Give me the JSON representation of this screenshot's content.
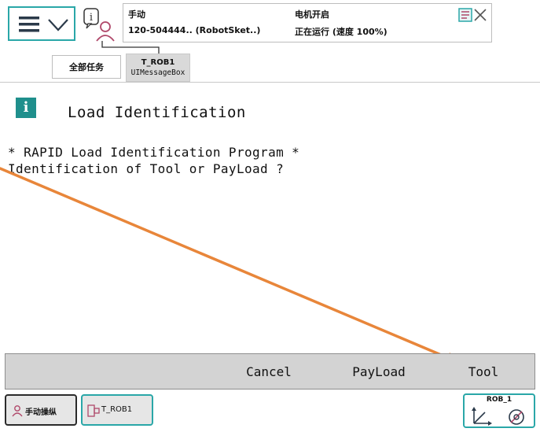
{
  "header": {
    "mode": "手动",
    "controller": "120-504444.. (RobotSket..)",
    "motor_state": "电机开启",
    "run_state": "正在运行 (速度 100%)"
  },
  "tabs": {
    "all_tasks": "全部任务",
    "task_name": "T_ROB1",
    "task_module": "UIMessageBox"
  },
  "message": {
    "title": "Load Identification",
    "lines": [
      "* RAPID Load Identification Program *",
      "Identification of Tool or PayLoad ?"
    ]
  },
  "buttons": {
    "cancel": "Cancel",
    "payload": "PayLoad",
    "tool": "Tool"
  },
  "taskbar": {
    "manual_jog": "手动操纵",
    "task": "T_ROB1",
    "mechunit": "ROB_1"
  },
  "colors": {
    "accent": "#2aa7a8",
    "info_icon": "#1f8f8c",
    "arrow": "#e8863a",
    "button_bar": "#d3d3d3"
  },
  "icons": {
    "menu": "hamburger-menu-icon",
    "messages": "message-person-icon",
    "close": "close-window-icon",
    "info": "info-icon",
    "quickset": "jog-coordinate-icon"
  }
}
